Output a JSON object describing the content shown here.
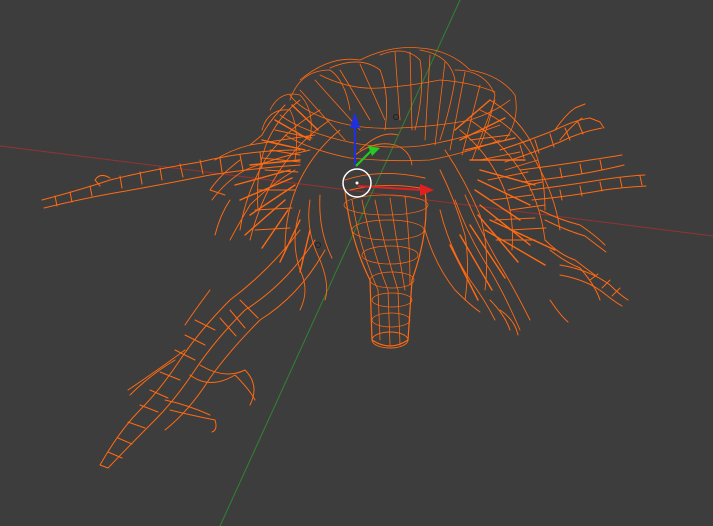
{
  "viewport": {
    "background": "#3d3d3d",
    "wire_color": "#ff6a13",
    "x_axis_color": "#b03030",
    "y_axis_color": "#2f8f2f",
    "gizmo": {
      "x_arrow_color": "#e02020",
      "y_arrow_color": "#22cc22",
      "z_arrow_color": "#2030e0",
      "pivot_ring_color": "#ffffff"
    }
  }
}
